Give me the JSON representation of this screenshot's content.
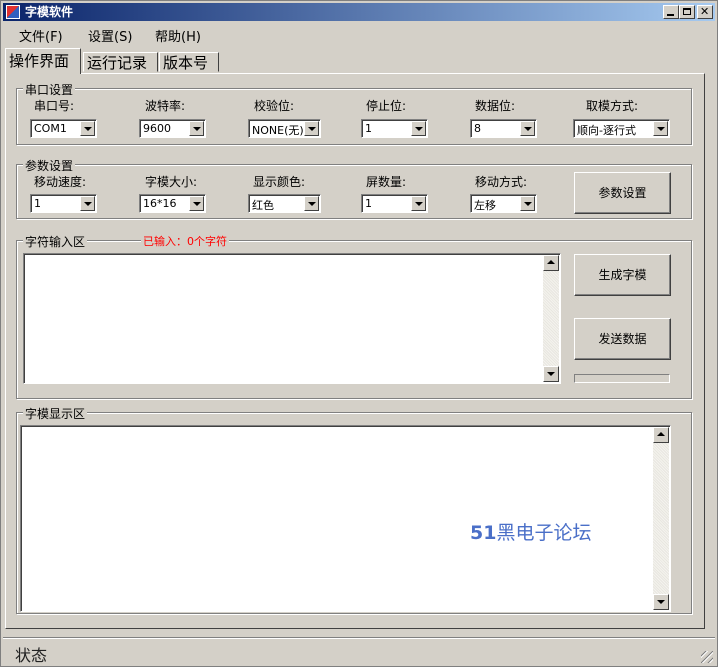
{
  "window": {
    "title": "字模软件"
  },
  "menu": {
    "file": "文件(F)",
    "settings": "设置(S)",
    "help": "帮助(H)"
  },
  "tabs": {
    "operation": "操作界面",
    "log": "运行记录",
    "version": "版本号"
  },
  "serial": {
    "title": "串口设置",
    "port_label": "串口号:",
    "port_value": "COM1",
    "baud_label": "波特率:",
    "baud_value": "9600",
    "parity_label": "校验位:",
    "parity_value": "NONE(无)",
    "stop_label": "停止位:",
    "stop_value": "1",
    "data_label": "数据位:",
    "data_value": "8",
    "mode_label": "取模方式:",
    "mode_value": "顺向-逐行式"
  },
  "params": {
    "title": "参数设置",
    "speed_label": "移动速度:",
    "speed_value": "1",
    "size_label": "字模大小:",
    "size_value": "16*16",
    "color_label": "显示颜色:",
    "color_value": "红色",
    "screens_label": "屏数量:",
    "screens_value": "1",
    "move_label": "移动方式:",
    "move_value": "左移",
    "apply_button": "参数设置"
  },
  "input": {
    "title": "字符输入区",
    "count": "已输入：0个字符",
    "generate_button": "生成字模",
    "send_button": "发送数据",
    "progress": 0
  },
  "display": {
    "title": "字模显示区",
    "watermark_num": "51",
    "watermark_text": "黑电子论坛"
  },
  "status": {
    "text": "状态"
  },
  "colors": {
    "accent_red": "#ff0000",
    "watermark": "#4a6fc8",
    "face": "#d4d0c8"
  }
}
